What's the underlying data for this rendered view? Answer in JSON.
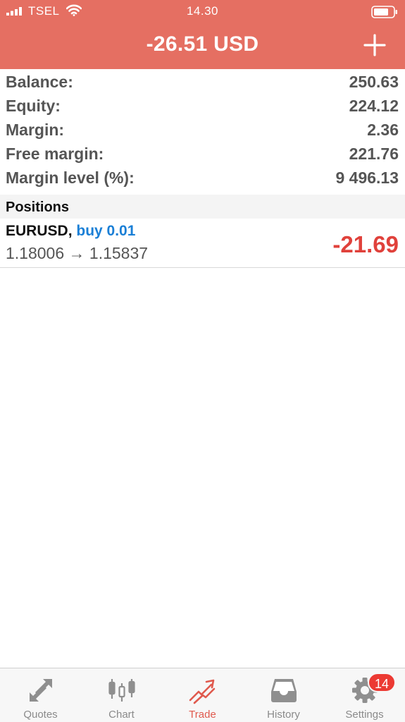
{
  "status_bar": {
    "carrier": "TSEL",
    "time": "14.30"
  },
  "header": {
    "title": "-26.51 USD",
    "add_icon": "plus-icon",
    "background_color": "#e56f62"
  },
  "summary": [
    {
      "label": "Balance:",
      "value": "250.63"
    },
    {
      "label": "Equity:",
      "value": "224.12"
    },
    {
      "label": "Margin:",
      "value": "2.36"
    },
    {
      "label": "Free margin:",
      "value": "221.76"
    },
    {
      "label": "Margin level (%):",
      "value": "9 496.13"
    }
  ],
  "positions": {
    "title": "Positions",
    "items": [
      {
        "symbol": "EURUSD",
        "separator": ",",
        "side": "buy 0.01",
        "open_price": "1.18006",
        "arrow": "→",
        "current_price": "1.15837",
        "profit": "-21.69"
      }
    ]
  },
  "tabs": [
    {
      "label": "Quotes",
      "icon": "quotes-arrows-icon",
      "active": false
    },
    {
      "label": "Chart",
      "icon": "candlestick-icon",
      "active": false
    },
    {
      "label": "Trade",
      "icon": "trade-trend-icon",
      "active": true
    },
    {
      "label": "History",
      "icon": "inbox-icon",
      "active": false
    },
    {
      "label": "Settings",
      "icon": "gear-icon",
      "active": false,
      "badge": "14"
    }
  ],
  "colors": {
    "accent": "#e56f62",
    "loss": "#e0413b",
    "buy": "#1a7fd6",
    "badge": "#ec3a33"
  }
}
